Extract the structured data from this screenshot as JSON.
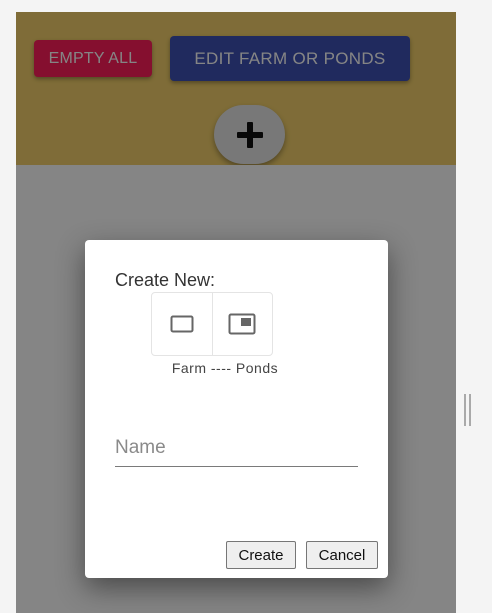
{
  "toolbar": {
    "empty_all_label": "EMPTY ALL",
    "edit_label": "EDIT FARM OR PONDS",
    "add_icon": "plus-icon"
  },
  "dialog": {
    "title": "Create New:",
    "choices": [
      {
        "icon": "farm-square-outline-icon"
      },
      {
        "icon": "ponds-picture-in-picture-icon"
      }
    ],
    "choice_caption": "Farm ---- Ponds",
    "name_placeholder": "Name",
    "name_value": "",
    "create_label": "Create",
    "cancel_label": "Cancel"
  },
  "colors": {
    "header_bg": "#f3d06b",
    "empty_all_bg": "#ff1e5a",
    "edit_bg": "#3f51b5",
    "backdrop": "rgba(0,0,0,0.48)"
  }
}
